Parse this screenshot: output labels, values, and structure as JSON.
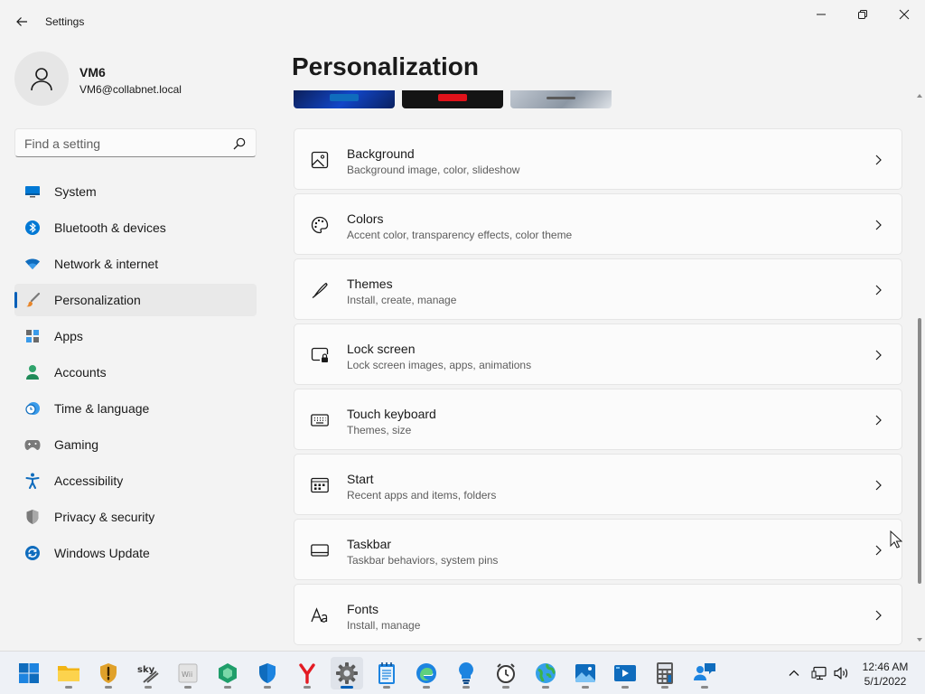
{
  "window": {
    "title": "Settings",
    "controls": {
      "minimize": "minimize-icon",
      "maximize": "maximize-icon",
      "close": "close-icon"
    }
  },
  "profile": {
    "name": "VM6",
    "email": "VM6@collabnet.local"
  },
  "search": {
    "placeholder": "Find a setting",
    "value": ""
  },
  "nav": {
    "items": [
      {
        "label": "System",
        "icon": "system-icon"
      },
      {
        "label": "Bluetooth & devices",
        "icon": "bluetooth-icon"
      },
      {
        "label": "Network & internet",
        "icon": "wifi-icon"
      },
      {
        "label": "Personalization",
        "icon": "brush-icon",
        "active": true
      },
      {
        "label": "Apps",
        "icon": "apps-icon"
      },
      {
        "label": "Accounts",
        "icon": "accounts-icon"
      },
      {
        "label": "Time & language",
        "icon": "clock-globe-icon"
      },
      {
        "label": "Gaming",
        "icon": "gamepad-icon"
      },
      {
        "label": "Accessibility",
        "icon": "accessibility-icon"
      },
      {
        "label": "Privacy & security",
        "icon": "shield-icon"
      },
      {
        "label": "Windows Update",
        "icon": "update-icon"
      }
    ]
  },
  "main": {
    "title": "Personalization",
    "cards": [
      {
        "title": "Background",
        "desc": "Background image, color, slideshow",
        "icon": "image-icon"
      },
      {
        "title": "Colors",
        "desc": "Accent color, transparency effects, color theme",
        "icon": "palette-icon"
      },
      {
        "title": "Themes",
        "desc": "Install, create, manage",
        "icon": "pen-icon"
      },
      {
        "title": "Lock screen",
        "desc": "Lock screen images, apps, animations",
        "icon": "lock-screen-icon"
      },
      {
        "title": "Touch keyboard",
        "desc": "Themes, size",
        "icon": "keyboard-icon"
      },
      {
        "title": "Start",
        "desc": "Recent apps and items, folders",
        "icon": "start-icon"
      },
      {
        "title": "Taskbar",
        "desc": "Taskbar behaviors, system pins",
        "icon": "taskbar-icon"
      },
      {
        "title": "Fonts",
        "desc": "Install, manage",
        "icon": "fonts-icon"
      }
    ]
  },
  "taskbar": {
    "apps": [
      "start-icon",
      "file-explorer-icon",
      "security-app-icon",
      "sky-app-icon",
      "wii-app-icon",
      "green-app-icon",
      "defender-shield-icon",
      "yandex-icon",
      "settings-gear-icon",
      "notepad-icon",
      "edge-icon",
      "lightbulb-app-icon",
      "alarm-clock-icon",
      "globe-app-icon",
      "photos-icon",
      "media-player-icon",
      "calculator-icon",
      "people-chat-icon"
    ],
    "active_app": "settings-gear-icon",
    "tray": [
      "chevron-up-icon",
      "network-icon",
      "volume-icon"
    ],
    "time": "12:46 AM",
    "date": "5/1/2022"
  },
  "colors": {
    "accent": "#005fb8",
    "background": "#f3f3f3",
    "card": "#fbfbfb"
  }
}
